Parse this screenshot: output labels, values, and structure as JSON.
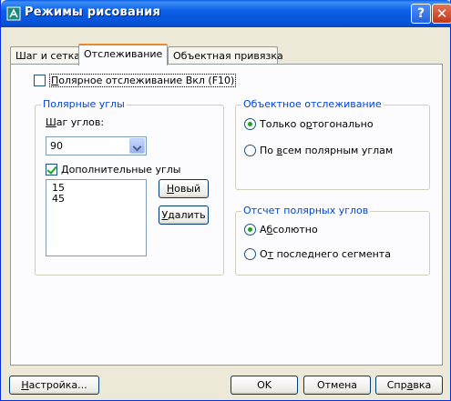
{
  "window": {
    "title": "Режимы рисования",
    "help_label": "?",
    "close_label": "✕"
  },
  "tabs": [
    {
      "label": "Шаг и сетка",
      "active": false
    },
    {
      "label": "Отслеживание",
      "active": true
    },
    {
      "label": "Объектная привязка",
      "active": false
    }
  ],
  "polar_tracking": {
    "enable_label_pre": "",
    "enable_label_u": "П",
    "enable_label_post": "олярное отслеживание Вкл (F10)",
    "enabled": false
  },
  "polar_angles": {
    "group_title": "Полярные углы",
    "step_label_u": "Ш",
    "step_label_post": "аг углов:",
    "step_value": "90",
    "additional_u": "Д",
    "additional_post": "ополнительные углы",
    "additional_checked": true,
    "angles": [
      "15",
      "45"
    ],
    "new_button_u": "Н",
    "new_button_post": "овый",
    "delete_button_u": "У",
    "delete_button_post": "далить"
  },
  "object_tracking": {
    "group_title": "Объектное отслеживание",
    "option1_pre": "Только о",
    "option1_u": "р",
    "option1_post": "тогонально",
    "option1_selected": true,
    "option2_pre": "По ",
    "option2_u": "в",
    "option2_post": "сем полярным углам",
    "option2_selected": false
  },
  "polar_measure": {
    "group_title": "Отсчет полярных углов",
    "option1_pre": "А",
    "option1_u": "б",
    "option1_post": "солютно",
    "option1_selected": true,
    "option2_pre": "О",
    "option2_u": "т",
    "option2_post": " последнего сегмента",
    "option2_selected": false
  },
  "footer": {
    "settings_u": "Н",
    "settings_post": "астройка...",
    "ok_label": "OK",
    "cancel_label": "Отмена",
    "help_pre": "Спр",
    "help_u": "а",
    "help_post": "вка"
  }
}
